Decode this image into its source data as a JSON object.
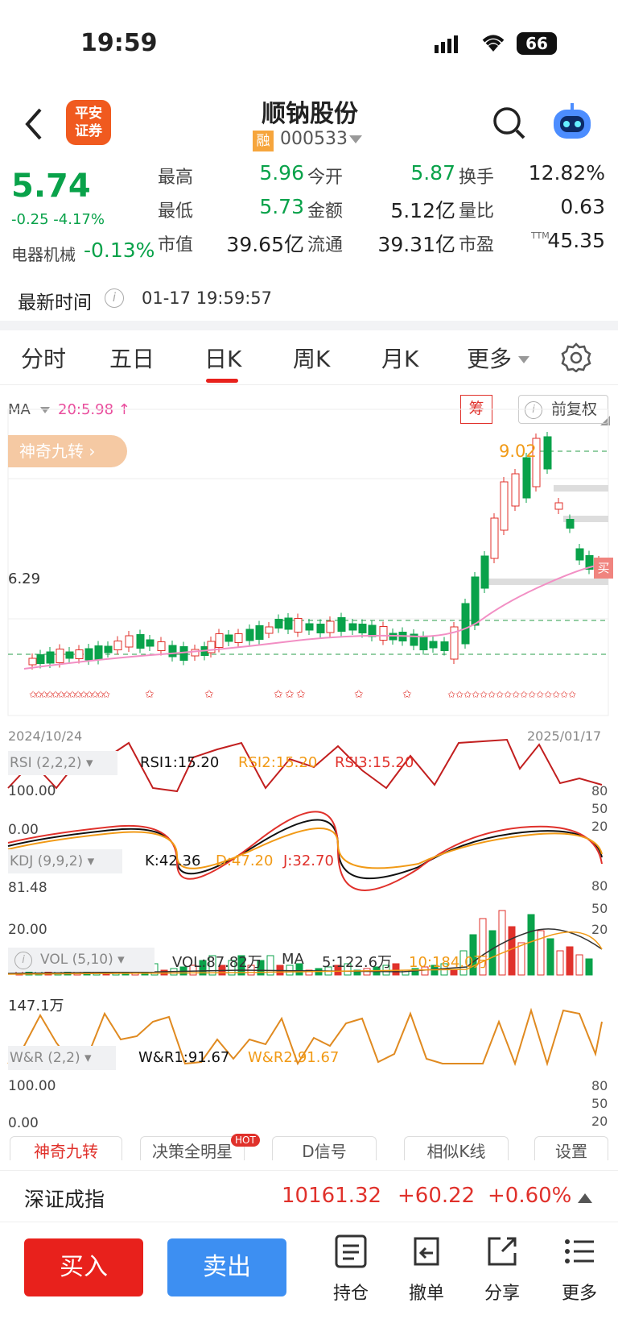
{
  "status_bar": {
    "time": "19:59",
    "battery": "66"
  },
  "header": {
    "title": "顺钠股份",
    "logo_line1": "平安",
    "logo_line2": "证券",
    "badge": "融",
    "code": "000533"
  },
  "quote": {
    "price": "5.74",
    "change": "-0.25 -4.17%",
    "sector_label": "电器机械",
    "sector_change": "-0.13%",
    "stats": [
      {
        "label": "最高",
        "value": "5.96",
        "color": "#09a24a"
      },
      {
        "label": "今开",
        "value": "5.87",
        "color": "#09a24a"
      },
      {
        "label": "换手",
        "value": "12.82%",
        "color": "#222"
      },
      {
        "label": "最低",
        "value": "5.73",
        "color": "#09a24a"
      },
      {
        "label": "金额",
        "value": "5.12亿",
        "color": "#222"
      },
      {
        "label": "量比",
        "value": "0.63",
        "color": "#222"
      },
      {
        "label": "市值",
        "value": "39.65亿",
        "color": "#222"
      },
      {
        "label": "流通",
        "value": "39.31亿",
        "color": "#222"
      },
      {
        "label": "市盈",
        "value": "45.35",
        "color": "#222"
      }
    ],
    "ttm": "TTM",
    "time_label": "最新时间",
    "time_value": "01-17 19:59:57"
  },
  "tabs": [
    "分时",
    "五日",
    "日K",
    "周K",
    "月K",
    "更多"
  ],
  "active_tab": "日K",
  "chart": {
    "ma_label": "MA",
    "ma_value": "20:5.98 ↑",
    "chou": "筹",
    "fq": "前复权",
    "magic_tag": "神奇九转 ›",
    "peak_label": "9.02",
    "price_6_29": "6.29",
    "axis_top": "9.0",
    "date_start": "2024/10/24",
    "date_end": "2025/01/17",
    "buy_tag": "买",
    "rsi": {
      "label": "RSI (2,2,2)",
      "v1": "RSI1:15.20",
      "v2": "RSI2:15.20",
      "v3": "RSI3:15.20",
      "y1": "100.00",
      "y2": "0.00",
      "r1": "80",
      "r2": "50",
      "r3": "20"
    },
    "kdj": {
      "label": "KDJ (9,9,2)",
      "k": "K:42.36",
      "d": "D:47.20",
      "j": "J:32.70",
      "y1": "81.48",
      "y2": "20.00",
      "r1": "80",
      "r2": "50",
      "r3": "20"
    },
    "vol": {
      "label": "VOL (5,10)",
      "vol": "VOL:87.82万",
      "ma": "MA",
      "ma5": "5:122.6万",
      "ma10": "10:184.0万",
      "y1": "147.1万"
    },
    "wr": {
      "label": "W&R (2,2)",
      "v1": "W&R1:91.67",
      "v2": "W&R2:91.67",
      "y1": "100.00",
      "y2": "0.00",
      "r1": "80",
      "r2": "50",
      "r3": "20"
    },
    "buttons": [
      "神奇九转",
      "决策全明星",
      "D信号",
      "相似K线",
      "设置"
    ],
    "hot": "HOT"
  },
  "index": {
    "name": "深证成指",
    "value": "10161.32",
    "change": "+60.22",
    "pct": "+0.60%"
  },
  "bottom": {
    "buy": "买入",
    "sell": "卖出",
    "items": [
      "持仓",
      "撤单",
      "分享",
      "更多"
    ]
  }
}
